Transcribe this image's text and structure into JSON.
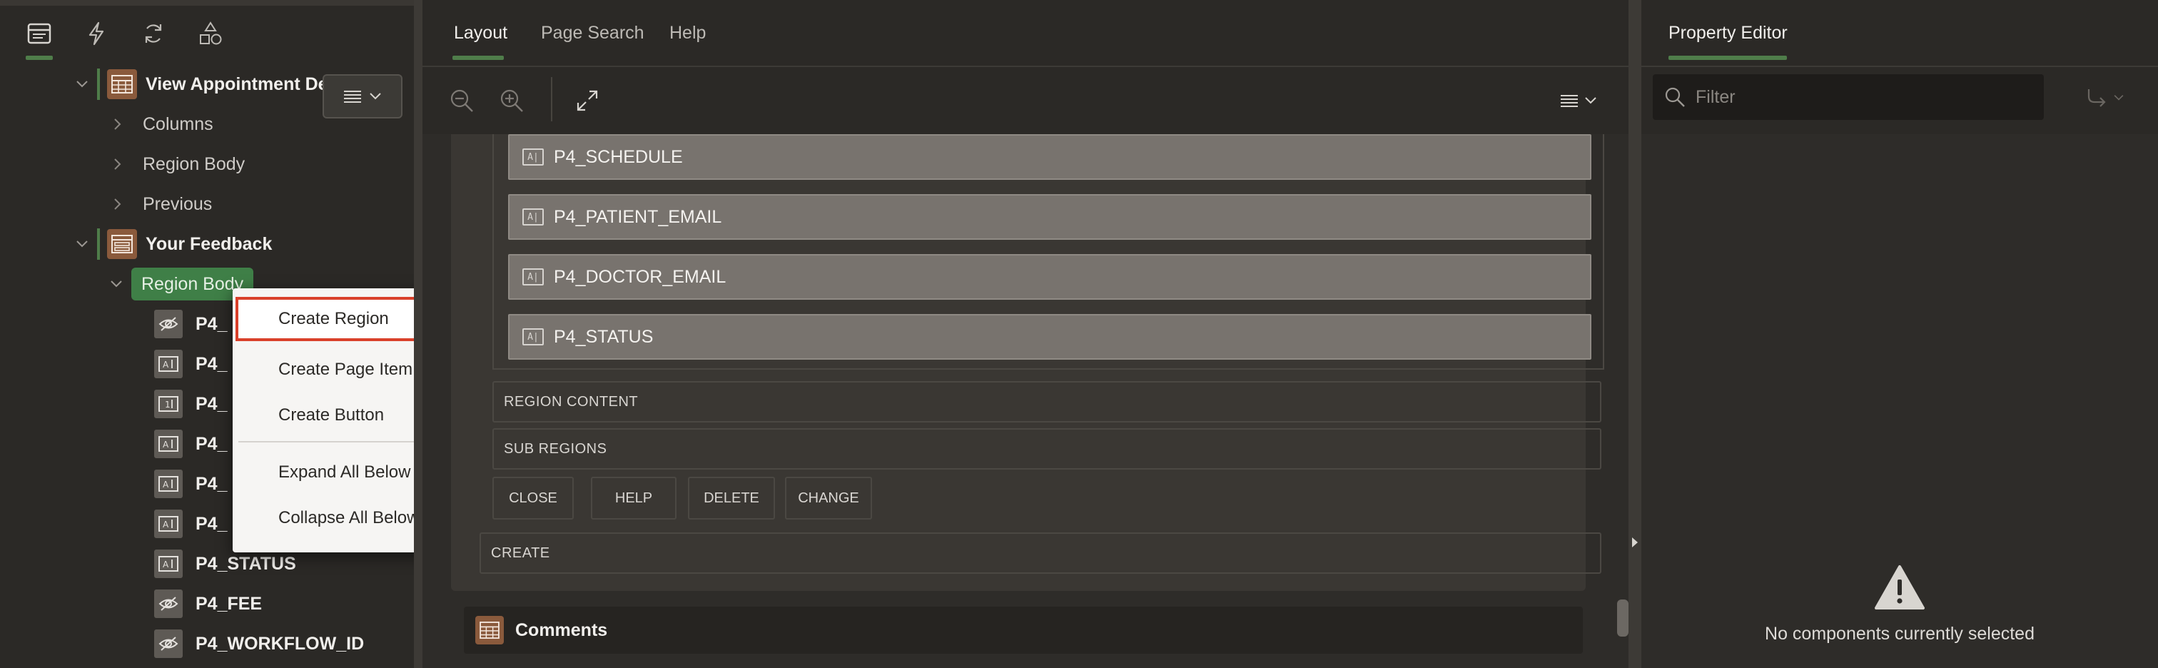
{
  "left_panel": {
    "tree": [
      {
        "label": "View Appointment Details",
        "bold": true,
        "type": "region-report"
      },
      {
        "label": "Columns",
        "bold": false
      },
      {
        "label": "Region Body",
        "bold": false
      },
      {
        "label": "Previous",
        "bold": false
      },
      {
        "label": "Your Feedback",
        "bold": true,
        "type": "region-form"
      },
      {
        "label": "Region Body",
        "bold": false,
        "selected": true
      }
    ],
    "items": [
      {
        "label": "P4_",
        "icon": "hidden-item-icon"
      },
      {
        "label": "P4_",
        "icon": "text-item-icon"
      },
      {
        "label": "P4_",
        "icon": "number-item-icon"
      },
      {
        "label": "P4_",
        "icon": "text-item-icon"
      },
      {
        "label": "P4_",
        "icon": "text-item-icon"
      },
      {
        "label": "P4_",
        "icon": "text-item-icon"
      },
      {
        "label": "P4_STATUS",
        "icon": "text-item-icon"
      },
      {
        "label": "P4_FEE",
        "icon": "hidden-item-icon"
      },
      {
        "label": "P4_WORKFLOW_ID",
        "icon": "hidden-item-icon"
      }
    ]
  },
  "context_menu": {
    "items": [
      "Create Region",
      "Create Page Item",
      "Create Button",
      "Expand All Below",
      "Collapse All Below"
    ],
    "highlighted": "Create Region",
    "highlight_color": "#d9402a"
  },
  "center": {
    "tabs": [
      "Layout",
      "Page Search",
      "Help"
    ],
    "active_tab": "Layout",
    "page_items": [
      "P4_SCHEDULE",
      "P4_PATIENT_EMAIL",
      "P4_DOCTOR_EMAIL",
      "P4_STATUS"
    ],
    "item_icon_text": "A|",
    "slots": [
      "REGION CONTENT",
      "SUB REGIONS"
    ],
    "buttons": [
      "CLOSE",
      "HELP",
      "DELETE",
      "CHANGE"
    ],
    "create_slot": "CREATE",
    "next_region": "Comments"
  },
  "right": {
    "title": "Property Editor",
    "filter_placeholder": "Filter",
    "empty_message": "No components currently selected"
  },
  "colors": {
    "accent_green": "#4f7d4a",
    "selected_pill": "#3f7f47",
    "region_icon_brown": "#8a5a3c"
  }
}
